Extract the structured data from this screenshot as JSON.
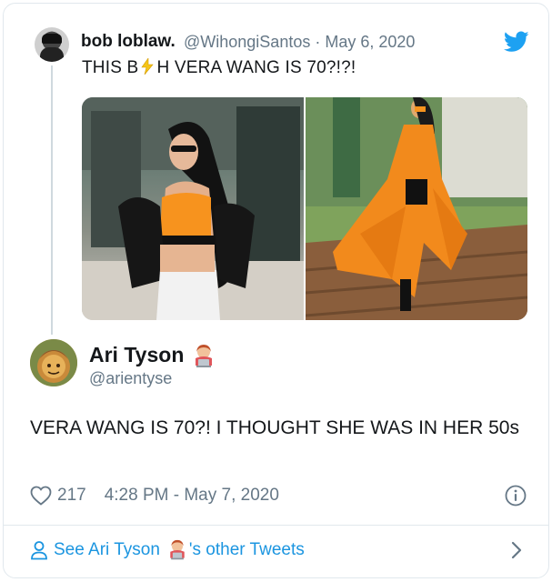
{
  "quoted_tweet": {
    "display_name": "bob loblaw.",
    "handle": "@WihongiSantos",
    "separator": "·",
    "date": "May 6, 2020",
    "text_before": "THIS B",
    "text_after": "H VERA WANG IS 70?!?!"
  },
  "icons": {
    "twitter": "twitter-bird-icon",
    "heart": "heart-outline-icon",
    "info": "info-icon",
    "person": "person-outline-icon",
    "chevron": "chevron-right-icon"
  },
  "colors": {
    "accent": "#1da1f2",
    "link": "#1b95e0",
    "muted": "#657786",
    "orange": "#f7931e"
  },
  "tweet": {
    "display_name": "Ari Tyson",
    "handle": "@arientyse",
    "body": "VERA WANG IS 70?! I THOUGHT SHE WAS IN HER 50s",
    "likes": "217",
    "timestamp": "4:28 PM - May 7, 2020"
  },
  "footer": {
    "see_prefix": "See Ari Tyson",
    "see_suffix": "'s other Tweets"
  }
}
